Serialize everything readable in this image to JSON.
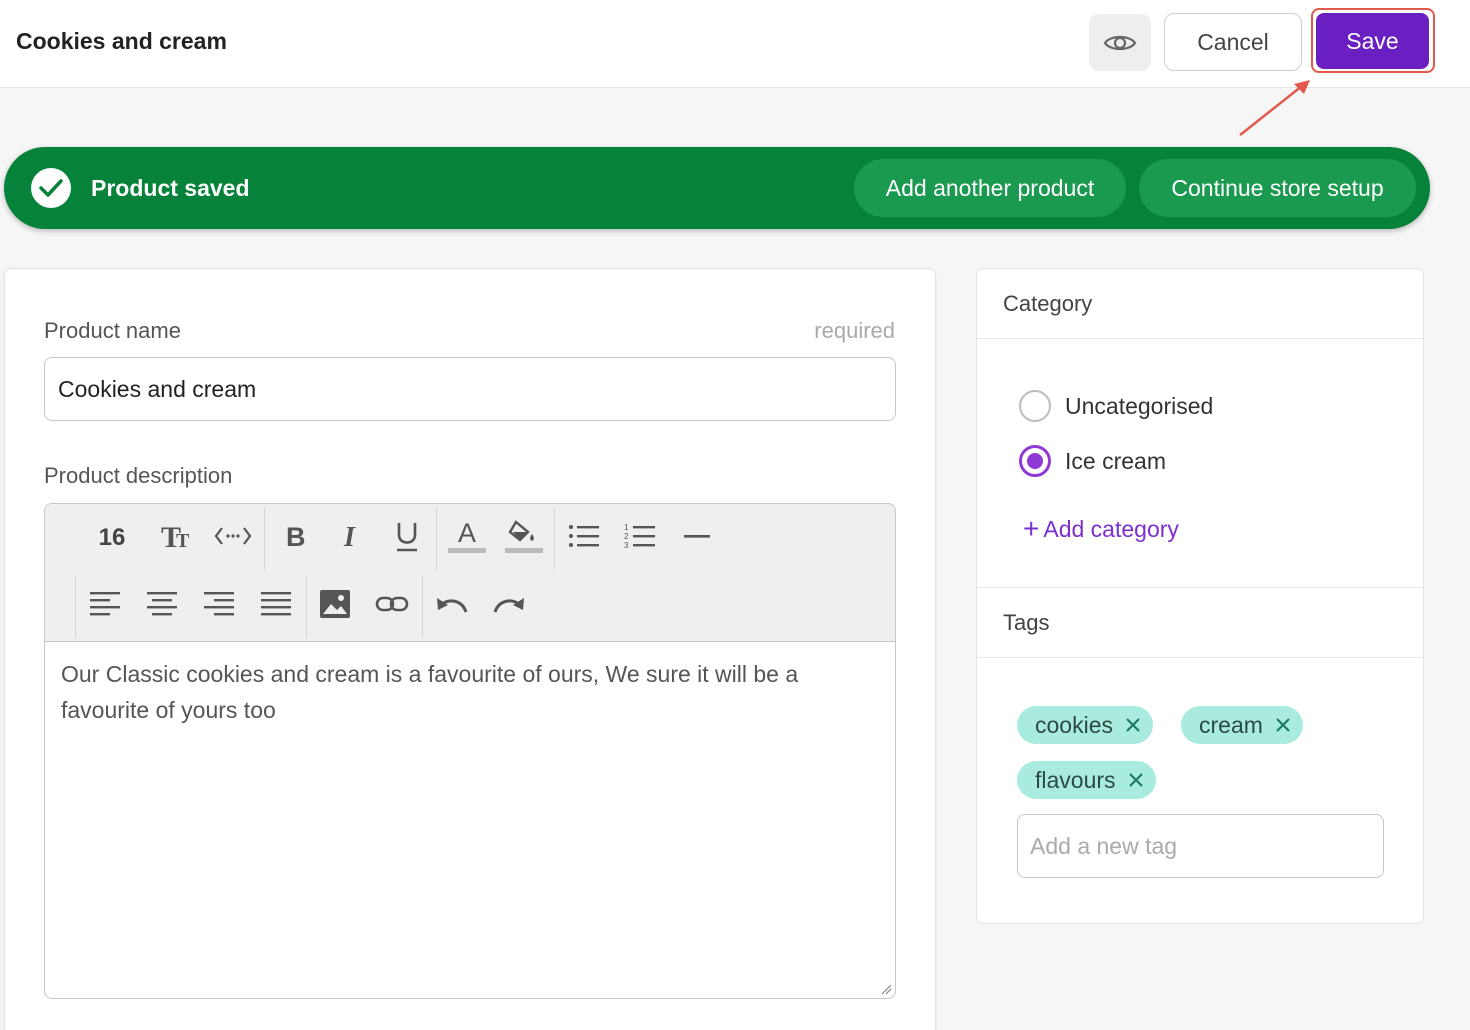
{
  "header": {
    "title": "Cookies and cream",
    "cancel_label": "Cancel",
    "save_label": "Save"
  },
  "banner": {
    "message": "Product saved",
    "add_another_label": "Add another product",
    "continue_label": "Continue store setup"
  },
  "product": {
    "name_label": "Product name",
    "required_label": "required",
    "name_value": "Cookies and cream",
    "description_label": "Product description",
    "font_size": "16",
    "description_text": "Our Classic cookies and cream is a favourite of ours, We sure it will be a favourite of yours too"
  },
  "category": {
    "title": "Category",
    "options": [
      {
        "label": "Uncategorised",
        "selected": false
      },
      {
        "label": "Ice cream",
        "selected": true
      }
    ],
    "add_label": "Add category"
  },
  "tags": {
    "title": "Tags",
    "items": [
      "cookies",
      "cream",
      "flavours"
    ],
    "input_placeholder": "Add a new tag"
  },
  "colors": {
    "primary": "#6a1fc2",
    "banner_green": "#07823a",
    "tag_bg": "#a9ecdf",
    "highlight": "#e2584c"
  }
}
